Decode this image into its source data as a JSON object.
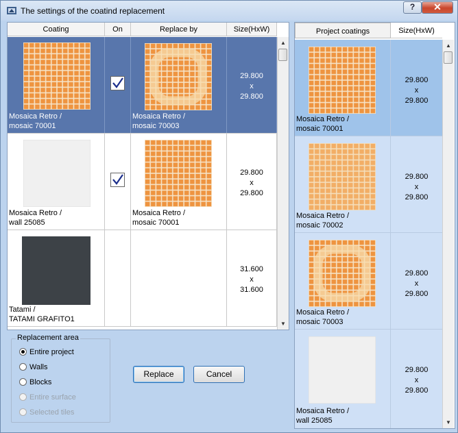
{
  "window": {
    "title": "The settings of the coatind replacement",
    "help_label": "?",
    "close_label": "✕"
  },
  "left_table": {
    "columns": [
      "Coating",
      "On",
      "Replace by",
      "Size(HxW)"
    ],
    "rows": [
      {
        "coating_line1": "Mosaica Retro /",
        "coating_line2": "mosaic 70001",
        "on": true,
        "replace_line1": "Mosaica Retro /",
        "replace_line2": "mosaic 70003",
        "size_h": "29.800",
        "size_x": "x",
        "size_w": "29.800",
        "selected": true
      },
      {
        "coating_line1": "Mosaica Retro /",
        "coating_line2": "wall 25085",
        "on": true,
        "replace_line1": "Mosaica Retro /",
        "replace_line2": "mosaic 70001",
        "size_h": "29.800",
        "size_x": "x",
        "size_w": "29.800",
        "selected": false
      },
      {
        "coating_line1": "Tatami /",
        "coating_line2": "TATAMI GRAFITO1",
        "on": false,
        "replace_line1": "",
        "replace_line2": "",
        "size_h": "31.600",
        "size_x": "x",
        "size_w": "31.600",
        "selected": false
      }
    ]
  },
  "replacement_area": {
    "label": "Replacement area",
    "options": [
      {
        "label": "Entire project",
        "checked": true,
        "enabled": true
      },
      {
        "label": "Walls",
        "checked": false,
        "enabled": true
      },
      {
        "label": "Blocks",
        "checked": false,
        "enabled": true
      },
      {
        "label": "Entire surface",
        "checked": false,
        "enabled": false
      },
      {
        "label": "Selected tiles",
        "checked": false,
        "enabled": false
      }
    ]
  },
  "buttons": {
    "replace": "Replace",
    "cancel": "Cancel"
  },
  "right_table": {
    "columns": [
      "Project coatings",
      "Size(HxW)"
    ],
    "rows": [
      {
        "line1": "Mosaica Retro /",
        "line2": "mosaic 70001",
        "size_h": "29.800",
        "size_x": "x",
        "size_w": "29.800",
        "selected": true
      },
      {
        "line1": "Mosaica Retro /",
        "line2": "mosaic 70002",
        "size_h": "29.800",
        "size_x": "x",
        "size_w": "29.800",
        "selected": false
      },
      {
        "line1": "Mosaica Retro /",
        "line2": "mosaic 70003",
        "size_h": "29.800",
        "size_x": "x",
        "size_w": "29.800",
        "selected": false
      },
      {
        "line1": "Mosaica Retro /",
        "line2": "wall 25085",
        "size_h": "29.800",
        "size_x": "x",
        "size_w": "29.800",
        "selected": false
      }
    ]
  },
  "colors": {
    "selection": "#5876ac",
    "window_bg": "#bcd3ee",
    "tile_orange": "#ee9440",
    "tile_grout": "#f6e4c8",
    "white_tile": "#f0f0f0",
    "dark_tile": "#3d4247"
  }
}
